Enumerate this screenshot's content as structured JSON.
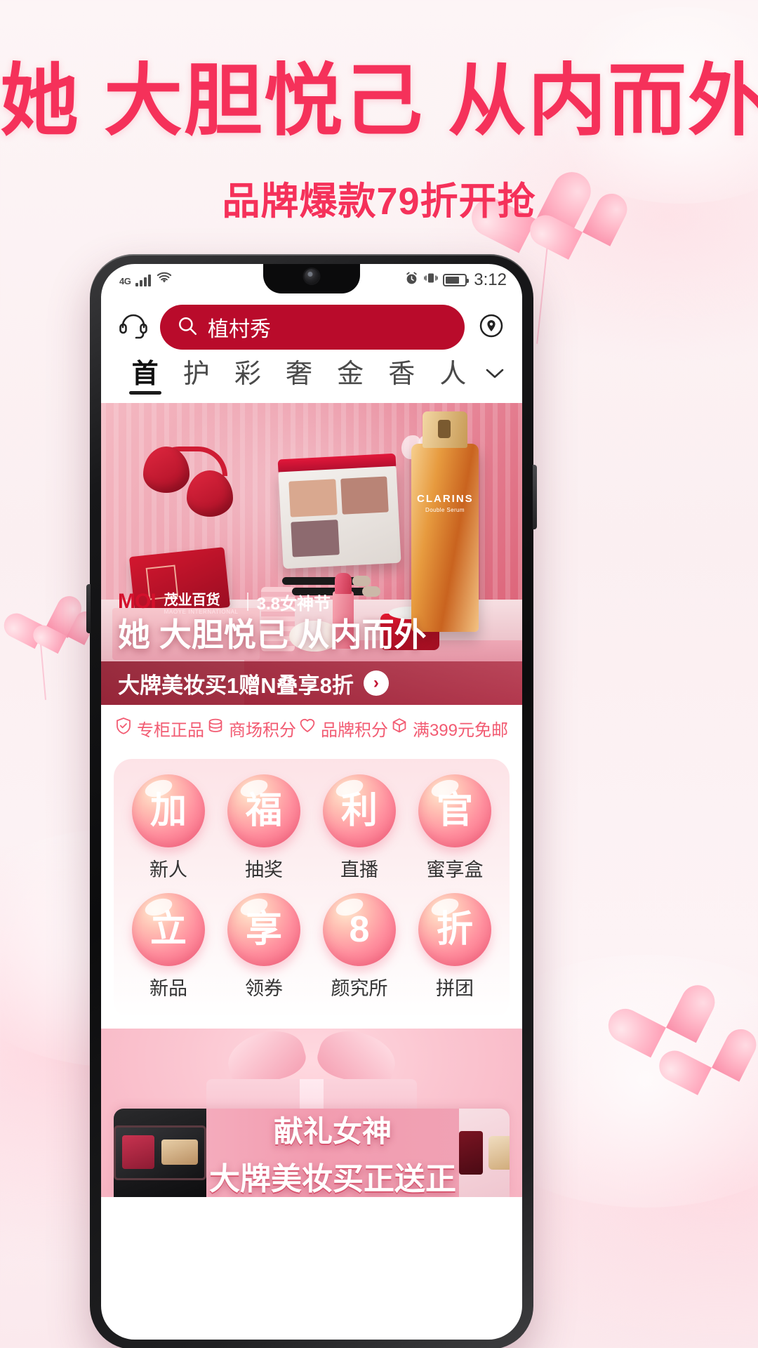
{
  "poster": {
    "headline_part1": "她",
    "headline_part2": "大胆悦己",
    "headline_part3": "从内而外",
    "subline": "品牌爆款79折开抢",
    "accent_color": "#f5315a"
  },
  "status_bar": {
    "network": "4G",
    "time": "3:12",
    "icons": [
      "signal-bars-icon",
      "wifi-icon",
      "alarm-icon",
      "vibrate-icon",
      "battery-icon"
    ]
  },
  "search": {
    "service_icon": "headset-icon",
    "search_icon": "search-icon",
    "keyword": "植村秀",
    "placeholder": "植村秀",
    "location_icon": "location-pin-icon",
    "bar_color": "#b90b2b"
  },
  "nav_tabs": [
    {
      "label": "首",
      "active": true
    },
    {
      "label": "护",
      "active": false
    },
    {
      "label": "彩",
      "active": false
    },
    {
      "label": "奢",
      "active": false
    },
    {
      "label": "金",
      "active": false
    },
    {
      "label": "香",
      "active": false
    },
    {
      "label": "人",
      "active": false
    }
  ],
  "nav_more_icon": "chevron-down-icon",
  "hero": {
    "brand_mark": "MOI",
    "brand_cn": "茂业百货",
    "brand_en": "MAOYE INTERNATIONAL",
    "festival": "3.8女神节",
    "title": "她 大胆悦己 从内而外",
    "subtitle": "大牌美妆买1赠N叠享8折",
    "arrow": "›",
    "product_label": "CLARINS",
    "product_sub": "Double Serum"
  },
  "benefits": [
    {
      "icon": "shield-check-icon",
      "label": "专柜正品"
    },
    {
      "icon": "coins-icon",
      "label": "商场积分"
    },
    {
      "icon": "heart-icon",
      "label": "品牌积分"
    },
    {
      "icon": "box-icon",
      "label": "满399元免邮"
    }
  ],
  "icon_grid": [
    {
      "glyph": "加",
      "label": "新人"
    },
    {
      "glyph": "福",
      "label": "抽奖"
    },
    {
      "glyph": "利",
      "label": "直播"
    },
    {
      "glyph": "官",
      "label": "蜜享盒"
    },
    {
      "glyph": "立",
      "label": "新品"
    },
    {
      "glyph": "享",
      "label": "领券"
    },
    {
      "glyph": "8",
      "label": "颜究所"
    },
    {
      "glyph": "折",
      "label": "拼团"
    }
  ],
  "gift_promo": {
    "line1": "献礼女神",
    "line2": "大牌美妆买正送正"
  }
}
